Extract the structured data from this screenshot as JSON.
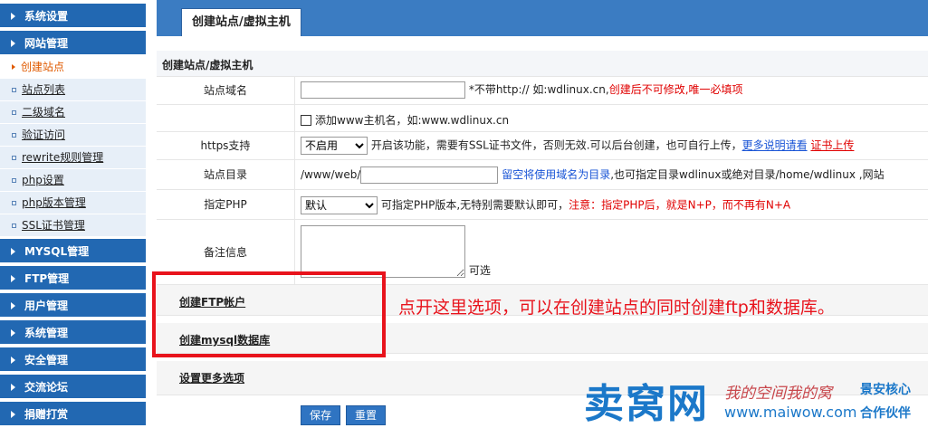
{
  "sidebar": {
    "sections": [
      {
        "label": "系统设置"
      },
      {
        "label": "网站管理"
      },
      {
        "label": "MYSQL管理"
      },
      {
        "label": "FTP管理"
      },
      {
        "label": "用户管理"
      },
      {
        "label": "系统管理"
      },
      {
        "label": "安全管理"
      },
      {
        "label": "交流论坛"
      },
      {
        "label": "捐赠打赏"
      }
    ],
    "website_items": [
      {
        "label": "创建站点",
        "active": true
      },
      {
        "label": "站点列表"
      },
      {
        "label": "二级域名"
      },
      {
        "label": "验证访问"
      },
      {
        "label": "rewrite规则管理"
      },
      {
        "label": "php设置"
      },
      {
        "label": "php版本管理"
      },
      {
        "label": "SSL证书管理"
      }
    ]
  },
  "main": {
    "tab": "创建站点/虚拟主机",
    "header": "创建站点/虚拟主机",
    "domain": {
      "label": "站点域名",
      "value": "",
      "note_black": "*不带http:// 如:wdlinux.cn,",
      "note_red": "创建后不可修改,唯一必填项"
    },
    "www": {
      "label": "添加www主机名，如:www.wdlinux.cn"
    },
    "https": {
      "label": "https支持",
      "selected": "不启用",
      "note": "开启该功能，需要有SSL证书文件，否则无效.可以后台创建，也可自行上传，",
      "link1": "更多说明请看",
      "link2": "证书上传"
    },
    "dir": {
      "label": "站点目录",
      "prefix": "/www/web/",
      "value": "",
      "note_blue": "留空将使用域名为目录",
      "note": ",也可指定目录wdlinux或绝对目录/home/wdlinux ,网站"
    },
    "php": {
      "label": "指定PHP",
      "selected": "默认",
      "note": "可指定PHP版本,无特别需要默认即可，",
      "note_red": "注意：指定PHP后，就是N+P，而不再有N+A"
    },
    "remark": {
      "label": "备注信息",
      "value": "",
      "hint": "可选"
    },
    "options": {
      "ftp": "创建FTP帐户",
      "mysql": "创建mysql数据库",
      "more": "设置更多选项"
    },
    "buttons": {
      "save": "保存",
      "reset": "重置"
    }
  },
  "annotation": "点开这里选项，可以在创建站点的同时创建ftp和数据库。",
  "watermark": {
    "brand": "卖窝网",
    "url": "www.maiwow.com",
    "script": "我的空间我的窝",
    "right1": "景安核心",
    "right2": "合作伙伴"
  },
  "colors": {
    "sidebar_blue": "#2268b2",
    "topbar_blue": "#3b7cc2",
    "annotation_red": "#e8131c",
    "link_blue": "#1a55d6"
  }
}
